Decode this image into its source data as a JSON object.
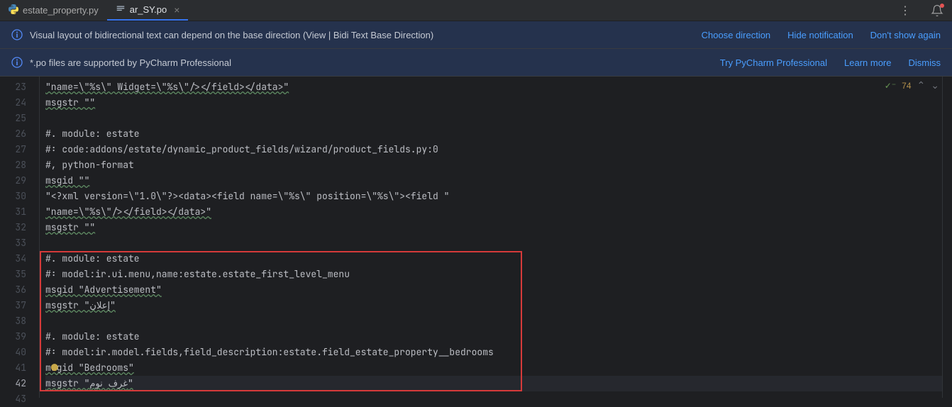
{
  "tabs": [
    {
      "label": "estate_property.py",
      "active": false
    },
    {
      "label": "ar_SY.po",
      "active": true
    }
  ],
  "banner1": {
    "text": "Visual layout of bidirectional text can depend on the base direction (View | Bidi Text Base Direction)",
    "links": [
      "Choose direction",
      "Hide notification",
      "Don't show again"
    ]
  },
  "banner2": {
    "text": "*.po files are supported by PyCharm Professional",
    "links": [
      "Try PyCharm Professional",
      "Learn more",
      "Dismiss"
    ]
  },
  "lines": [
    {
      "n": 23,
      "content": "\"name=\\\"%s\\\" Widget=\\\"%s\\\"/></field></data>\""
    },
    {
      "n": 24,
      "content": "msgstr \"\""
    },
    {
      "n": 25,
      "content": ""
    },
    {
      "n": 26,
      "content": "#. module: estate"
    },
    {
      "n": 27,
      "content": "#: code:addons/estate/dynamic_product_fields/wizard/product_fields.py:0"
    },
    {
      "n": 28,
      "content": "#, python-format"
    },
    {
      "n": 29,
      "content": "msgid \"\""
    },
    {
      "n": 30,
      "content": "\"<?xml version=\\\"1.0\\\"?><data><field name=\\\"%s\\\" position=\\\"%s\\\"><field \""
    },
    {
      "n": 31,
      "content": "\"name=\\\"%s\\\"/></field></data>\""
    },
    {
      "n": 32,
      "content": "msgstr \"\""
    },
    {
      "n": 33,
      "content": ""
    },
    {
      "n": 34,
      "content": "#. module: estate"
    },
    {
      "n": 35,
      "content": "#: model:ir.ui.menu,name:estate.estate_first_level_menu"
    },
    {
      "n": 36,
      "content": "msgid \"Advertisement\""
    },
    {
      "n": 37,
      "content": "msgstr \"إعلان\""
    },
    {
      "n": 38,
      "content": ""
    },
    {
      "n": 39,
      "content": "#. module: estate"
    },
    {
      "n": 40,
      "content": "#: model:ir.model.fields,field_description:estate.field_estate_property__bedrooms"
    },
    {
      "n": 41,
      "content": "msgid \"Bedrooms\""
    },
    {
      "n": 42,
      "content": "msgstr \"غرف نوم\""
    },
    {
      "n": 43,
      "content": ""
    }
  ],
  "status": {
    "warnCount": "74"
  }
}
